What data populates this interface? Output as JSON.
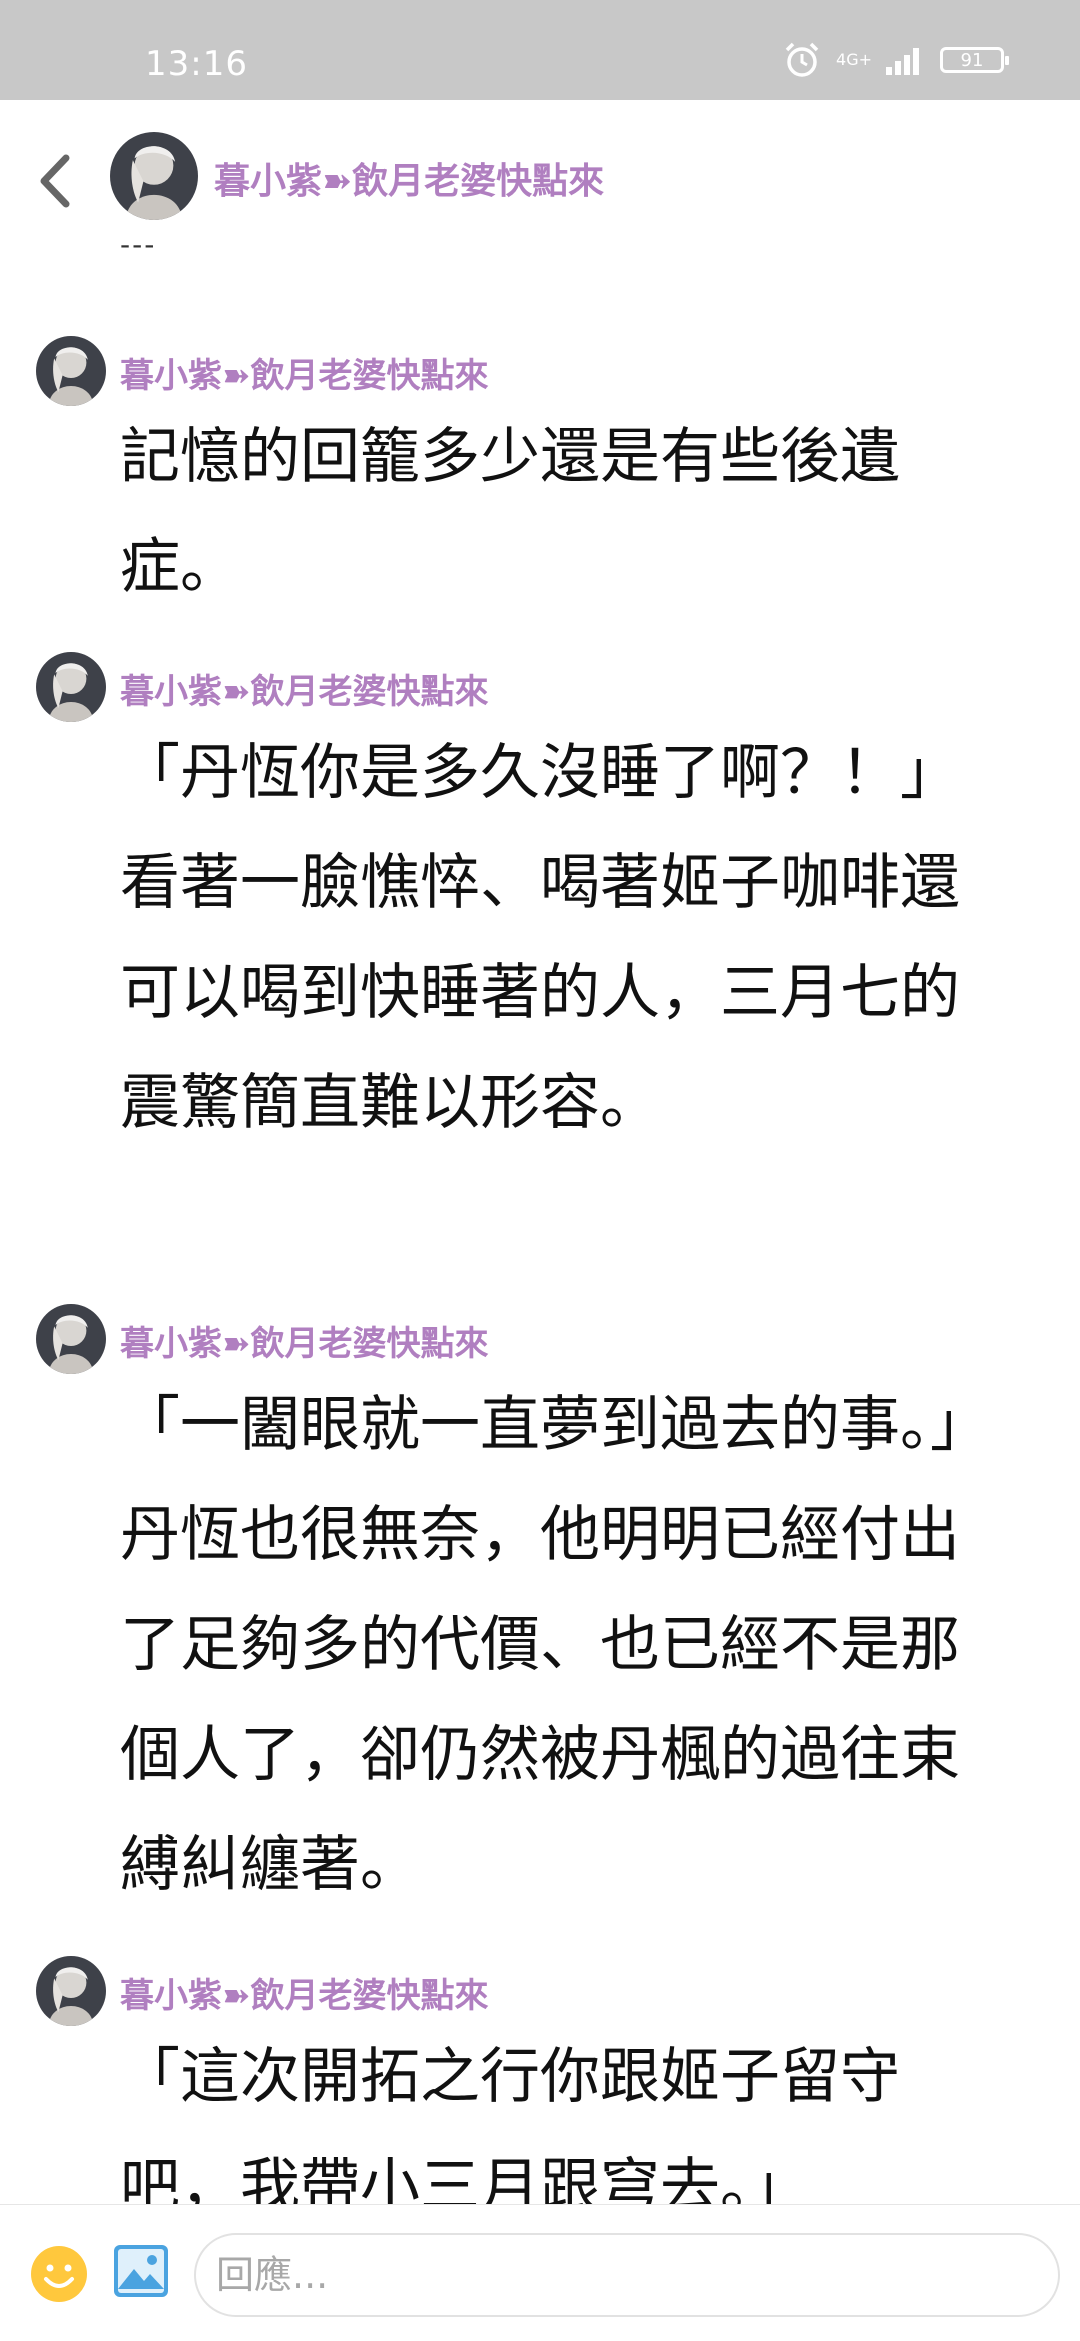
{
  "status_bar": {
    "time": "13:16",
    "network": "4G+",
    "battery": "91"
  },
  "header": {
    "title": "暮小紫➽飲月老婆快點來",
    "subtitle": "---"
  },
  "posts": [
    {
      "author": "暮小紫➽飲月老婆快點來",
      "text": "記憶的回籠多少還是有些後遺症。"
    },
    {
      "author": "暮小紫➽飲月老婆快點來",
      "text": "「丹恆你是多久沒睡了啊？！」看著一臉憔悴、喝著姬子咖啡還可以喝到快睡著的人，三月七的震驚簡直難以形容。"
    },
    {
      "author": "暮小紫➽飲月老婆快點來",
      "text": "「一闔眼就一直夢到過去的事。」丹恆也很無奈，他明明已經付出了足夠多的代價、也已經不是那個人了，卻仍然被丹楓的過往束縛糾纏著。"
    },
    {
      "author": "暮小紫➽飲月老婆快點來",
      "text": "「這次開拓之行你跟姬子留守吧，我帶小三月跟穹去。」"
    }
  ],
  "footer": {
    "reply_placeholder": "回應..."
  },
  "icons": {
    "back": "chevron-left-icon",
    "emoji": "smiley-icon",
    "image": "image-icon",
    "alarm": "alarm-clock-icon",
    "signal": "signal-icon",
    "battery": "battery-icon"
  },
  "colors": {
    "status_bar_bg": "#c8c8c8",
    "author_name": "#b07fc0",
    "emoji_yellow": "#ffc83d",
    "image_blue": "#4aa3e0"
  }
}
